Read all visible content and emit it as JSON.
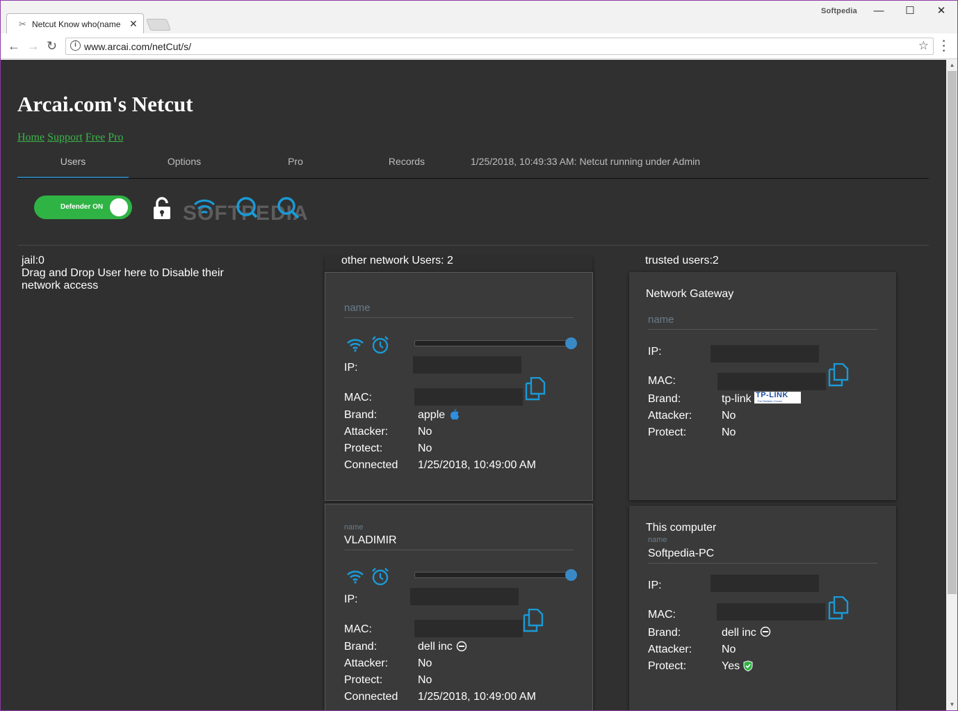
{
  "browser": {
    "tab_title": "Netcut Know who(name",
    "tab_close": "✕",
    "brand_tag": "Softpedia",
    "url": "www.arcai.com/netCut/s/",
    "info_glyph": "i",
    "star_glyph": "☆",
    "window_controls": {
      "minimize": "—",
      "maximize": "☐",
      "close": "✕"
    },
    "nav": {
      "back": "←",
      "forward": "→",
      "reload": "↻"
    }
  },
  "page": {
    "title": "Arcai.com's Netcut",
    "links": [
      "Home",
      "Support",
      "Free",
      "Pro"
    ],
    "tabs": [
      "Users",
      "Options",
      "Pro",
      "Records"
    ],
    "active_tab": "Users",
    "status": "1/25/2018, 10:49:33 AM: Netcut running under Admin",
    "defender_label": "Defender ON",
    "watermark": "SOFTPEDIA",
    "jail_count": "jail:0",
    "jail_hint": "Drag and Drop User here to Disable their network access",
    "other_header": "other network Users: 2",
    "trusted_header": "trusted users:2"
  },
  "labels": {
    "name": "name",
    "ip": "IP:",
    "mac": "MAC:",
    "brand": "Brand:",
    "attacker": "Attacker:",
    "protect": "Protect:",
    "connected": "Connected"
  },
  "other_users": [
    {
      "name": "",
      "brand": "apple",
      "attacker": "No",
      "protect": "No",
      "connected": "1/25/2018, 10:49:00 AM",
      "speed_fraction": 1.0
    },
    {
      "name": "VLADIMIR",
      "brand": "dell inc",
      "attacker": "No",
      "protect": "No",
      "connected": "1/25/2018, 10:49:00 AM",
      "speed_fraction": 1.0
    }
  ],
  "trusted_users": [
    {
      "title": "Network Gateway",
      "name": "",
      "brand": "tp-link",
      "brand_logo": "TP-LINK",
      "brand_logo_sub": "The Reliable Choice",
      "attacker": "No",
      "protect": "No"
    },
    {
      "title": "This computer",
      "name": "Softpedia-PC",
      "brand": "dell inc",
      "attacker": "No",
      "protect": "Yes"
    }
  ],
  "colors": {
    "background": "#303030",
    "card": "#3a3a3a",
    "accent_blue": "#1a9ad6",
    "toggle_green": "#2fb344",
    "link_green": "#3bb44a"
  },
  "icons": [
    "wifi-icon",
    "alarm-icon",
    "copy-icon",
    "lock-icon",
    "apple-icon",
    "dell-icon",
    "shield-icon"
  ]
}
